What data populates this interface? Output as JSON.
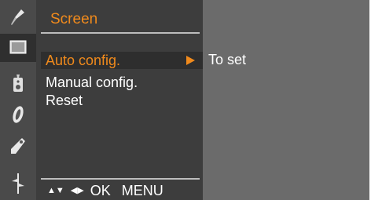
{
  "menu": {
    "title": "Screen",
    "items": [
      {
        "label": "Auto config.",
        "selected": true
      },
      {
        "label": "Manual config.",
        "selected": false
      },
      {
        "label": "Reset",
        "selected": false
      }
    ]
  },
  "status": {
    "text": "To set"
  },
  "help": {
    "nav_updown": "▲▼",
    "nav_leftright": "◀▶",
    "ok": "OK",
    "menu": "MENU"
  },
  "icons": [
    "picture-icon",
    "screen-icon",
    "ezvideo-icon",
    "option-icon",
    "tag-icon",
    "special-icon"
  ],
  "colors": {
    "accent": "#f08a1c",
    "panel": "#3d3d3d",
    "background": "#6b6b6b",
    "text": "#ffffff"
  }
}
